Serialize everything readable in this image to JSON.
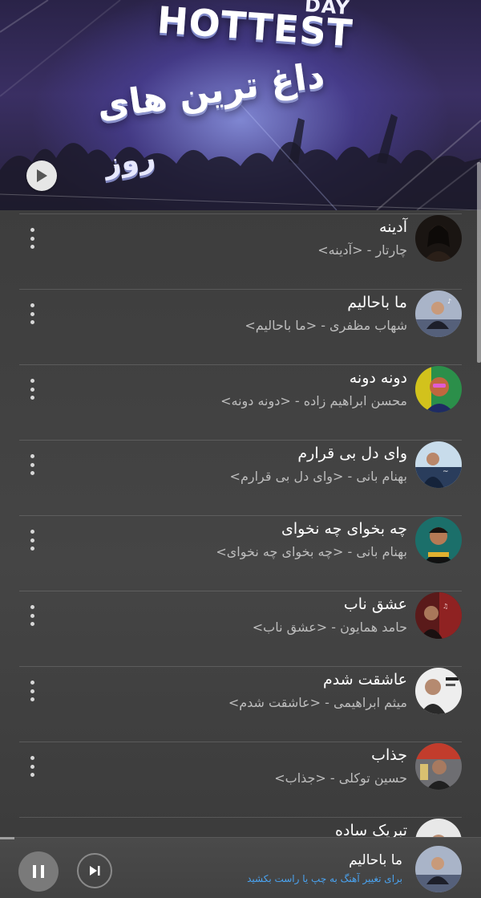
{
  "hero": {
    "day": "DAY",
    "hottest": "HOTTEST",
    "persian_title": "داغ ترین های",
    "persian_subtitle": "روز"
  },
  "tracks": [
    {
      "title": "آدینه",
      "subtitle": "چارتار - <آدینه>"
    },
    {
      "title": "ما باحالیم",
      "subtitle": "شهاب مظفری - <ما باحالیم>"
    },
    {
      "title": "دونه دونه",
      "subtitle": "محسن ابراهیم زاده - <دونه دونه>"
    },
    {
      "title": "وای دل بی قرارم",
      "subtitle": "بهنام بانی - <وای دل بی قرارم>"
    },
    {
      "title": "چه بخوای چه نخوای",
      "subtitle": "بهنام بانی - <چه بخوای چه نخوای>"
    },
    {
      "title": "عشق ناب",
      "subtitle": "حامد همایون - <عشق ناب>"
    },
    {
      "title": "عاشقت شدم",
      "subtitle": "میثم ابراهیمی - <عاشقت شدم>"
    },
    {
      "title": "جذاب",
      "subtitle": "حسین توکلی - <جذاب>"
    },
    {
      "title": "تبریک ساده",
      "subtitle": ""
    }
  ],
  "now_playing": {
    "title": "ما باحالیم",
    "hint": "برای تغییر آهنگ به چپ یا راست بکشید",
    "progress": 0.03
  },
  "colors": {
    "hint": "#4aa3f0",
    "background": "#3d3d3d"
  }
}
